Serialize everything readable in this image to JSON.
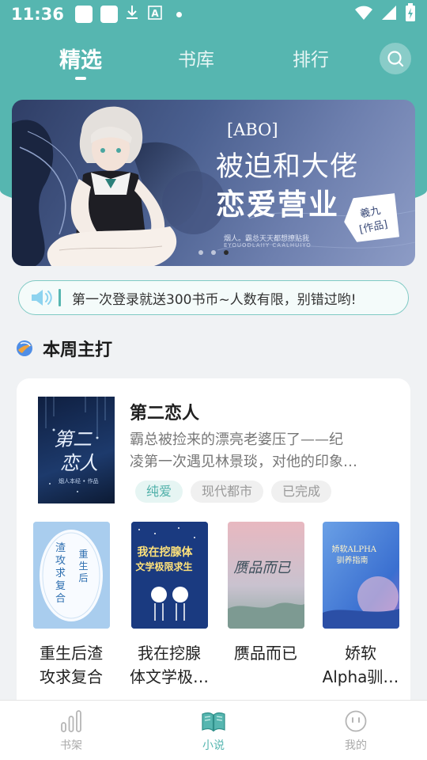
{
  "status_bar": {
    "time": "11:36",
    "icons": [
      "notification-square",
      "notification-square",
      "download-icon",
      "text-a-icon",
      "dot",
      "wifi-icon",
      "cell-signal-icon",
      "battery-charging-icon"
    ]
  },
  "top_tabs": {
    "items": [
      "精选",
      "书库",
      "排行"
    ],
    "active": "精选"
  },
  "banner": {
    "tag": "[ABO]",
    "line1": "被迫和大佬",
    "line2": "恋爱营业",
    "sub1": "烟人。霸总天天都想撩贴我",
    "sub2": "EYOUODLAIIY CAALHUIYO",
    "badge_line1": "羲九",
    "badge_line2": "[作品]",
    "page_count": 3,
    "active_page": 3
  },
  "notice": {
    "text": "第一次登录就送300书币~人数有限，别错过哟!"
  },
  "section": {
    "title": "本周主打"
  },
  "featured": {
    "title": "第二恋人",
    "desc_line1": "霸总被捡来的漂亮老婆压了——纪",
    "desc_line2": "凌第一次遇见林景琰，对他的印象…",
    "tags": [
      "纯爱",
      "现代都市",
      "已完成"
    ],
    "cover_text1": "第二",
    "cover_text2": "恋人",
    "cover_author": "烟人本经 • 作品"
  },
  "books": [
    {
      "line1": "重生后渣",
      "line2": "攻求复合",
      "cover_text": "渣攻求复合",
      "cover_text2": "重生后"
    },
    {
      "line1": "我在挖腺",
      "line2": "体文学极…",
      "cover_text": "我在挖腺体",
      "cover_text2": "文学极限求生"
    },
    {
      "line1": "赝品而已",
      "line2": "",
      "cover_text": "赝品而已",
      "cover_text2": ""
    },
    {
      "line1": "娇软",
      "line2": "Alpha驯…",
      "cover_text": "娇软ALPHA",
      "cover_text2": "驯养指南"
    }
  ],
  "bottom_nav": {
    "items": [
      {
        "label": "书架",
        "icon": "bar-chart-icon"
      },
      {
        "label": "小说",
        "icon": "open-book-icon"
      },
      {
        "label": "我的",
        "icon": "face-icon"
      }
    ],
    "active": "小说"
  },
  "colors": {
    "teal": "#56b6b0",
    "banner_blue": "#4a5f8f"
  }
}
